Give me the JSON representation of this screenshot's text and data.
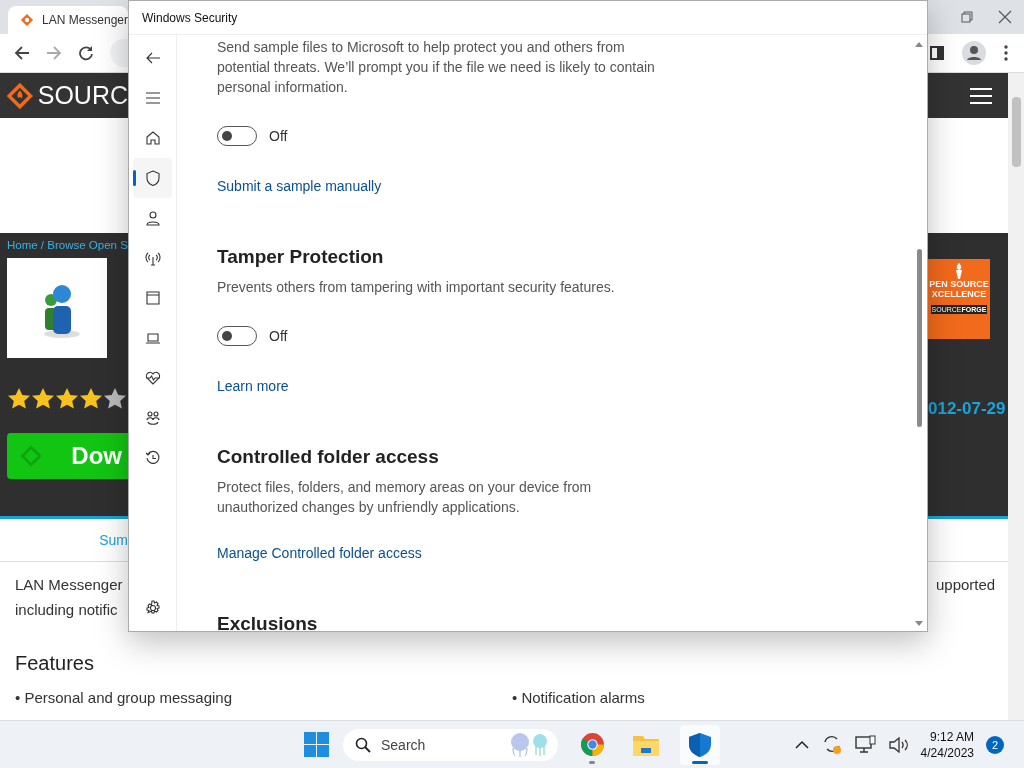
{
  "browser": {
    "tab_title": "LAN Messenger",
    "site": {
      "logo_text": "SOURC",
      "breadcrumb": "Home / Browse Open S",
      "rating": {
        "stars": 4
      },
      "download_label": "Dow",
      "award": {
        "line_1": "PEN SOURCE",
        "line_2": "XCELLENCE",
        "brand": "SOURCE**FORGE**"
      },
      "date": "012-07-29",
      "tab_link": "Sum",
      "description_left": [
        "LAN Messenger",
        "including notific"
      ],
      "description_right": "upported",
      "features_heading": "Features",
      "features": [
        "• Personal and group messaging",
        "• Notification alarms"
      ]
    }
  },
  "security_window": {
    "title": "Windows Security",
    "nav": [
      {
        "kind": "back",
        "selected": false
      },
      {
        "kind": "menu",
        "selected": false
      },
      {
        "kind": "home",
        "selected": false
      },
      {
        "kind": "shield",
        "selected": true
      },
      {
        "kind": "account",
        "selected": false
      },
      {
        "kind": "network",
        "selected": false
      },
      {
        "kind": "app-browser",
        "selected": false
      },
      {
        "kind": "device",
        "selected": false
      },
      {
        "kind": "health",
        "selected": false
      },
      {
        "kind": "family",
        "selected": false
      },
      {
        "kind": "history",
        "selected": false
      },
      {
        "kind": "settings",
        "selected": false
      }
    ],
    "sections": [
      {
        "text": "Send sample files to Microsoft to help protect you and others from potential threats. We’ll prompt you if the file we need is likely to contain personal information.",
        "toggle": {
          "on": false,
          "label": "Off"
        },
        "link": "Submit a sample manually"
      },
      {
        "heading": "Tamper Protection",
        "text": "Prevents others from tampering with important security features.",
        "toggle": {
          "on": false,
          "label": "Off"
        },
        "link": "Learn more"
      },
      {
        "heading": "Controlled folder access",
        "text": "Protect files, folders, and memory areas on your device from unauthorized changes by unfriendly applications.",
        "link": "Manage Controlled folder access"
      },
      {
        "heading": "Exclusions"
      }
    ]
  },
  "taskbar": {
    "search_placeholder": "Search",
    "apps": [
      {
        "kind": "chrome",
        "running": true,
        "active": false
      },
      {
        "kind": "folder",
        "running": false,
        "active": false
      },
      {
        "kind": "shield",
        "running": true,
        "active": true
      }
    ],
    "time": "9:12 AM",
    "date": "4/24/2023",
    "notifications": "2"
  }
}
